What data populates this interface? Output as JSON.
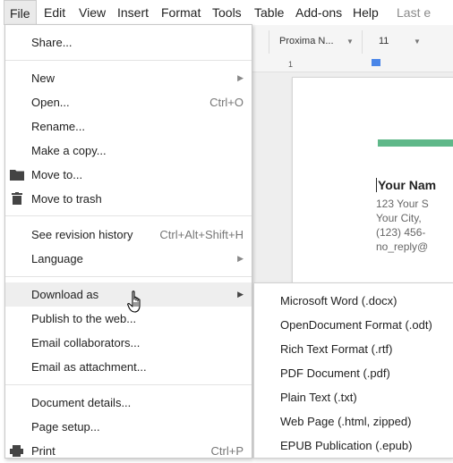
{
  "menubar": {
    "items": [
      "File",
      "Edit",
      "View",
      "Insert",
      "Format",
      "Tools",
      "Table",
      "Add-ons",
      "Help"
    ],
    "last_edit": "Last e"
  },
  "toolbar": {
    "font": "Proxima N...",
    "size": "11"
  },
  "ruler": {
    "mark": "1"
  },
  "document": {
    "name": "Your Nam",
    "lines": [
      "123 Your S",
      "Your City, ",
      "(123) 456-",
      "no_reply@"
    ]
  },
  "file_menu": {
    "share": "Share...",
    "new": "New",
    "open": "Open...",
    "open_shortcut": "Ctrl+O",
    "rename": "Rename...",
    "make_copy": "Make a copy...",
    "move_to": "Move to...",
    "move_to_trash": "Move to trash",
    "revision_history": "See revision history",
    "revision_shortcut": "Ctrl+Alt+Shift+H",
    "language": "Language",
    "download_as": "Download as",
    "publish": "Publish to the web...",
    "email_collaborators": "Email collaborators...",
    "email_attachment": "Email as attachment...",
    "document_details": "Document details...",
    "page_setup": "Page setup...",
    "print": "Print",
    "print_shortcut": "Ctrl+P"
  },
  "download_submenu": [
    "Microsoft Word (.docx)",
    "OpenDocument Format (.odt)",
    "Rich Text Format (.rtf)",
    "PDF Document (.pdf)",
    "Plain Text (.txt)",
    "Web Page (.html, zipped)",
    "EPUB Publication (.epub)"
  ],
  "colors": {
    "accent_bar": "#5fb889",
    "menu_highlight": "#eeeeee"
  },
  "icons": [
    "folder-icon",
    "trash-icon",
    "print-icon",
    "submenu-arrow-icon",
    "hand-cursor-icon"
  ]
}
